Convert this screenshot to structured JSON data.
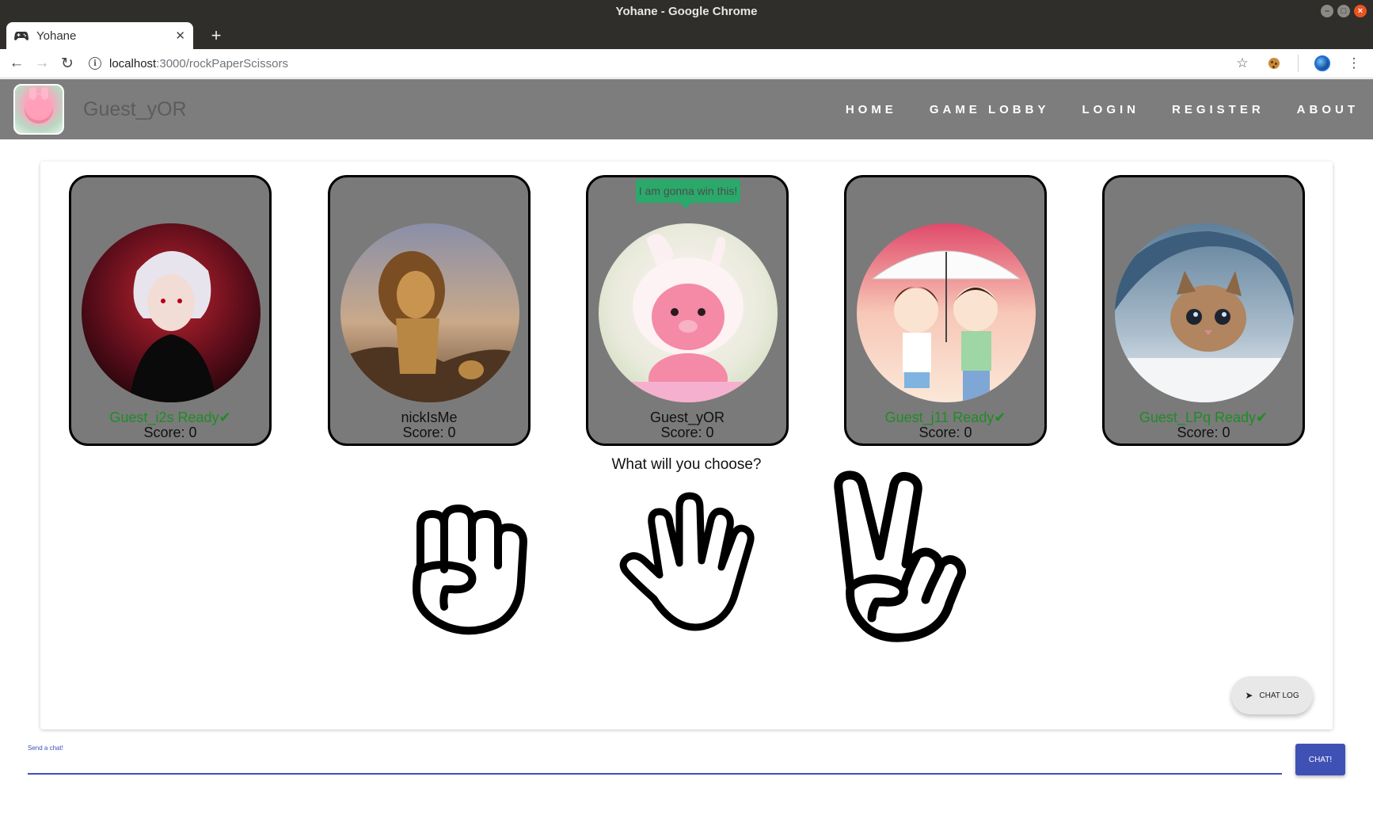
{
  "browser": {
    "window_title": "Yohane - Google Chrome",
    "tab_title": "Yohane",
    "url_host": "localhost",
    "url_path": ":3000/rockPaperScissors"
  },
  "nav": {
    "username": "Guest_yOR",
    "links": [
      "HOME",
      "GAME LOBBY",
      "LOGIN",
      "REGISTER",
      "ABOUT"
    ]
  },
  "game": {
    "players": [
      {
        "name": "Guest_i2s Ready✔",
        "score": "Score: 0",
        "ready": true,
        "avatar": "anime-character-avatar"
      },
      {
        "name": "nickIsMe",
        "score": "Score: 0",
        "ready": false,
        "avatar": "lion-avatar"
      },
      {
        "name": "Guest_yOR",
        "score": "Score: 0",
        "ready": false,
        "avatar": "pink-bunny-avatar",
        "chat_bubble": "I am gonna win this!"
      },
      {
        "name": "Guest_j11 Ready✔",
        "score": "Score: 0",
        "ready": true,
        "avatar": "couple-umbrella-avatar"
      },
      {
        "name": "Guest_LPq Ready✔",
        "score": "Score: 0",
        "ready": true,
        "avatar": "kitten-avatar"
      }
    ],
    "prompt": "What will you choose?",
    "choices": [
      "rock-icon",
      "paper-icon",
      "scissors-icon"
    ],
    "chat_log_button": "CHAT LOG"
  },
  "chat": {
    "label": "Send a chat!",
    "value": "",
    "send_label": "CHAT!"
  },
  "colors": {
    "navbar": "#7d7d7d",
    "card": "#7a7a7a",
    "ready": "#1f8c25",
    "bubble": "#2aa96b",
    "primary": "#3f51b5"
  }
}
